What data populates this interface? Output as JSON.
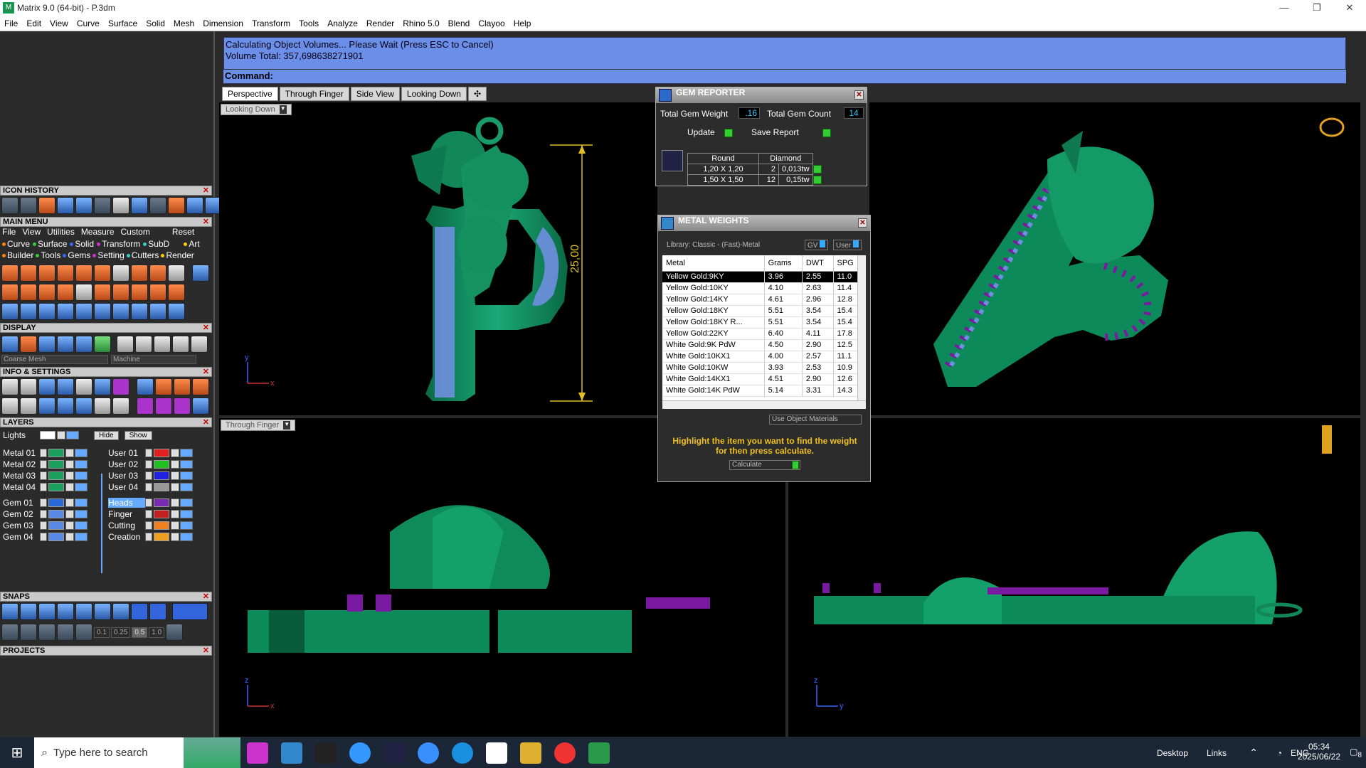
{
  "window": {
    "title": "Matrix 9.0 (64-bit) - P.3dm",
    "minimize": "—",
    "restore": "❐",
    "close": "✕"
  },
  "menubar": [
    "File",
    "Edit",
    "View",
    "Curve",
    "Surface",
    "Solid",
    "Mesh",
    "Dimension",
    "Transform",
    "Tools",
    "Analyze",
    "Render",
    "Rhino 5.0",
    "Blend",
    "Clayoo",
    "Help"
  ],
  "command": {
    "line1": "Calculating Object Volumes... Please Wait (Press ESC to Cancel)",
    "line2": "Volume Total: 357,698638271901",
    "prompt": "Command:"
  },
  "viewport_tabs": [
    "Perspective",
    "Through Finger",
    "Side View",
    "Looking Down"
  ],
  "viewports": {
    "top_left": "Looking Down",
    "bottom_left": "Through Finger",
    "dimension": "25,00"
  },
  "left": {
    "icon_history": "ICON HISTORY",
    "main_menu": "MAIN MENU",
    "main_menu_items": [
      "File",
      "View",
      "Utilities",
      "Measure",
      "Custom",
      "Reset"
    ],
    "cat_row1": [
      "Curve",
      "Surface",
      "Solid",
      "Transform",
      "SubD",
      "Art"
    ],
    "cat_row2": [
      "Builder",
      "Tools",
      "Gems",
      "Setting",
      "Cutters",
      "Render"
    ],
    "display": "DISPLAY",
    "display_sel1": "Coarse Mesh",
    "display_sel2": "Machine",
    "info": "INFO & SETTINGS",
    "layers": "LAYERS",
    "lights": "Lights",
    "hide": "Hide",
    "show": "Show",
    "layers_left": [
      "Metal 01",
      "Metal 02",
      "Metal 03",
      "Metal 04",
      "Gem 01",
      "Gem 02",
      "Gem 03",
      "Gem 04"
    ],
    "layers_right": [
      "User 01",
      "User 02",
      "User 03",
      "User 04",
      "Heads",
      "Finger",
      "Cutting",
      "Creation"
    ],
    "snaps": "SNAPS",
    "snap_values": [
      "0.1",
      "0.25",
      "0.5",
      "1.0"
    ],
    "projects": "PROJECTS"
  },
  "gem_reporter": {
    "title": "GEM REPORTER",
    "total_weight_label": "Total Gem Weight",
    "total_weight": ".16",
    "total_count_label": "Total Gem Count",
    "total_count": "14",
    "update": "Update",
    "save_report": "Save Report",
    "shape": "Round",
    "material": "Diamond",
    "rows": [
      {
        "size": "1,20 X 1,20",
        "count": "2",
        "weight": "0,013tw"
      },
      {
        "size": "1,50 X 1,50",
        "count": "12",
        "weight": "0,15tw"
      }
    ]
  },
  "metal_weights": {
    "title": "METAL WEIGHTS",
    "library": "Library: Classic - (Fast)-Metal",
    "btn_gv": "GV",
    "btn_user": "User",
    "headers": [
      "Metal",
      "Grams",
      "DWT",
      "SPG"
    ],
    "rows": [
      [
        "Yellow Gold:9KY",
        "3.96",
        "2.55",
        "11.0"
      ],
      [
        "Yellow Gold:10KY",
        "4.10",
        "2.63",
        "11.4"
      ],
      [
        "Yellow Gold:14KY",
        "4.61",
        "2.96",
        "12.8"
      ],
      [
        "Yellow Gold:18KY",
        "5.51",
        "3.54",
        "15.4"
      ],
      [
        "Yellow Gold:18KY R...",
        "5.51",
        "3.54",
        "15.4"
      ],
      [
        "Yellow Gold:22KY",
        "6.40",
        "4.11",
        "17.8"
      ],
      [
        "White Gold:9K PdW",
        "4.50",
        "2.90",
        "12.5"
      ],
      [
        "White Gold:10KX1",
        "4.00",
        "2.57",
        "11.1"
      ],
      [
        "White Gold:10KW",
        "3.93",
        "2.53",
        "10.9"
      ],
      [
        "White Gold:14KX1",
        "4.51",
        "2.90",
        "12.6"
      ],
      [
        "White Gold:14K PdW",
        "5.14",
        "3.31",
        "14.3"
      ]
    ],
    "use_obj": "Use Object Materials",
    "hint": "Highlight the item you want to find the weight for then press calculate.",
    "calculate": "Calculate"
  },
  "taskbar": {
    "search": "Type here to search",
    "desktop": "Desktop",
    "links": "Links",
    "lang": "ENG",
    "time": "05:34",
    "date": "2025/06/22",
    "notif": "8"
  },
  "colors": {
    "jewel": "#0c8a5a",
    "gem": "#6f8fe0",
    "prong": "#7a1aa0",
    "cmd": "#6b8fe8"
  }
}
